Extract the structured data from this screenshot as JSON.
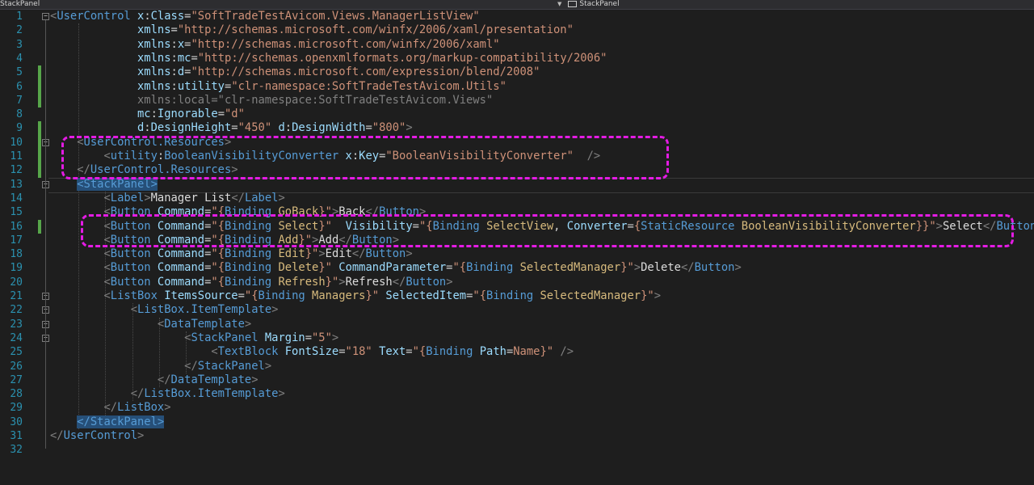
{
  "editor": {
    "nav_left": "StackPanel",
    "nav_right": "StackPanel",
    "line_numbers": [
      "1",
      "2",
      "3",
      "4",
      "5",
      "6",
      "7",
      "8",
      "9",
      "10",
      "11",
      "12",
      "13",
      "14",
      "15",
      "16",
      "17",
      "18",
      "19",
      "20",
      "21",
      "22",
      "23",
      "24",
      "25",
      "26",
      "27",
      "28",
      "29",
      "30",
      "31",
      "32"
    ],
    "lines": [
      [
        [
          "d",
          "<"
        ],
        [
          "t",
          "UserControl"
        ],
        [
          "p",
          " "
        ],
        [
          "a",
          "x"
        ],
        [
          "p",
          ":"
        ],
        [
          "a",
          "Class"
        ],
        [
          "p",
          "="
        ],
        [
          "v",
          "\"SoftTradeTestAvicom.Views.ManagerListView\""
        ]
      ],
      [
        [
          "p",
          "             "
        ],
        [
          "a",
          "xmlns"
        ],
        [
          "p",
          "="
        ],
        [
          "v",
          "\"http://schemas.microsoft.com/winfx/2006/xaml/presentation\""
        ]
      ],
      [
        [
          "p",
          "             "
        ],
        [
          "a",
          "xmlns"
        ],
        [
          "p",
          ":"
        ],
        [
          "a",
          "x"
        ],
        [
          "p",
          "="
        ],
        [
          "v",
          "\"http://schemas.microsoft.com/winfx/2006/xaml\""
        ]
      ],
      [
        [
          "p",
          "             "
        ],
        [
          "a",
          "xmlns"
        ],
        [
          "p",
          ":"
        ],
        [
          "a",
          "mc"
        ],
        [
          "p",
          "="
        ],
        [
          "v",
          "\"http://schemas.openxmlformats.org/markup-compatibility/2006\""
        ]
      ],
      [
        [
          "p",
          "             "
        ],
        [
          "a",
          "xmlns"
        ],
        [
          "p",
          ":"
        ],
        [
          "a",
          "d"
        ],
        [
          "p",
          "="
        ],
        [
          "v",
          "\"http://schemas.microsoft.com/expression/blend/2008\""
        ]
      ],
      [
        [
          "p",
          "             "
        ],
        [
          "a",
          "xmlns"
        ],
        [
          "p",
          ":"
        ],
        [
          "a",
          "utility"
        ],
        [
          "p",
          "="
        ],
        [
          "v",
          "\"clr-namespace:SoftTradeTestAvicom.Utils\""
        ]
      ],
      [
        [
          "p",
          "             "
        ],
        [
          "d",
          "xmlns:local=\"clr-namespace:SoftTradeTestAvicom.Views\""
        ]
      ],
      [
        [
          "p",
          "             "
        ],
        [
          "a",
          "mc"
        ],
        [
          "p",
          ":"
        ],
        [
          "a",
          "Ignorable"
        ],
        [
          "p",
          "="
        ],
        [
          "v",
          "\"d\""
        ]
      ],
      [
        [
          "p",
          "             "
        ],
        [
          "a",
          "d"
        ],
        [
          "p",
          ":"
        ],
        [
          "a",
          "DesignHeight"
        ],
        [
          "p",
          "="
        ],
        [
          "v",
          "\"450\""
        ],
        [
          "p",
          " "
        ],
        [
          "a",
          "d"
        ],
        [
          "p",
          ":"
        ],
        [
          "a",
          "DesignWidth"
        ],
        [
          "p",
          "="
        ],
        [
          "v",
          "\"800\""
        ],
        [
          "d",
          ">"
        ]
      ],
      [
        [
          "p",
          "    "
        ],
        [
          "d",
          "<"
        ],
        [
          "t",
          "UserControl.Resources"
        ],
        [
          "d",
          ">"
        ]
      ],
      [
        [
          "p",
          "        "
        ],
        [
          "d",
          "<"
        ],
        [
          "t",
          "utility"
        ],
        [
          "p",
          ":"
        ],
        [
          "t",
          "BooleanVisibilityConverter"
        ],
        [
          "p",
          " "
        ],
        [
          "a",
          "x"
        ],
        [
          "p",
          ":"
        ],
        [
          "a",
          "Key"
        ],
        [
          "p",
          "="
        ],
        [
          "v",
          "\"BooleanVisibilityConverter\""
        ],
        [
          "p",
          "  "
        ],
        [
          "d",
          "/>"
        ]
      ],
      [
        [
          "p",
          "    "
        ],
        [
          "d",
          "</"
        ],
        [
          "t",
          "UserControl.Resources"
        ],
        [
          "d",
          ">"
        ]
      ],
      [
        [
          "p",
          "    "
        ],
        [
          "hl",
          "<StackPanel>"
        ]
      ],
      [
        [
          "p",
          "        "
        ],
        [
          "d",
          "<"
        ],
        [
          "t",
          "Label"
        ],
        [
          "d",
          ">"
        ],
        [
          "txt",
          "Manager List"
        ],
        [
          "d",
          "</"
        ],
        [
          "t",
          "Label"
        ],
        [
          "d",
          ">"
        ]
      ],
      [
        [
          "p",
          "        "
        ],
        [
          "d",
          "<"
        ],
        [
          "t",
          "Button"
        ],
        [
          "p",
          " "
        ],
        [
          "a",
          "Command"
        ],
        [
          "p",
          "="
        ],
        [
          "v",
          "\"{"
        ],
        [
          "t",
          "Binding"
        ],
        [
          "p",
          " "
        ],
        [
          "bnd",
          "GoBack"
        ],
        [
          "v",
          "}\""
        ],
        [
          "d",
          ">"
        ],
        [
          "txt",
          "Back"
        ],
        [
          "d",
          "</"
        ],
        [
          "t",
          "Button"
        ],
        [
          "d",
          ">"
        ]
      ],
      [
        [
          "p",
          "        "
        ],
        [
          "d",
          "<"
        ],
        [
          "t",
          "Button"
        ],
        [
          "p",
          " "
        ],
        [
          "a",
          "Command"
        ],
        [
          "p",
          "="
        ],
        [
          "v",
          "\"{"
        ],
        [
          "t",
          "Binding"
        ],
        [
          "p",
          " "
        ],
        [
          "bnd",
          "Select"
        ],
        [
          "v",
          "}\""
        ],
        [
          "p",
          "  "
        ],
        [
          "a",
          "Visibility"
        ],
        [
          "p",
          "="
        ],
        [
          "v",
          "\"{"
        ],
        [
          "t",
          "Binding"
        ],
        [
          "p",
          " "
        ],
        [
          "bnd",
          "SelectView"
        ],
        [
          "p",
          ", "
        ],
        [
          "a",
          "Converter"
        ],
        [
          "p",
          "="
        ],
        [
          "v",
          "{"
        ],
        [
          "t",
          "StaticResource"
        ],
        [
          "p",
          " "
        ],
        [
          "bnd",
          "BooleanVisibilityConverter"
        ],
        [
          "v",
          "}}\""
        ],
        [
          "d",
          ">"
        ],
        [
          "txt",
          "Select"
        ],
        [
          "d",
          "</"
        ],
        [
          "t",
          "Button"
        ],
        [
          "d",
          ">"
        ]
      ],
      [
        [
          "p",
          "        "
        ],
        [
          "d",
          "<"
        ],
        [
          "t",
          "Button"
        ],
        [
          "p",
          " "
        ],
        [
          "a",
          "Command"
        ],
        [
          "p",
          "="
        ],
        [
          "v",
          "\"{"
        ],
        [
          "t",
          "Binding"
        ],
        [
          "p",
          " "
        ],
        [
          "bnd",
          "Add"
        ],
        [
          "v",
          "}\""
        ],
        [
          "d",
          ">"
        ],
        [
          "txt",
          "Add"
        ],
        [
          "d",
          "</"
        ],
        [
          "t",
          "Button"
        ],
        [
          "d",
          ">"
        ]
      ],
      [
        [
          "p",
          "        "
        ],
        [
          "d",
          "<"
        ],
        [
          "t",
          "Button"
        ],
        [
          "p",
          " "
        ],
        [
          "a",
          "Command"
        ],
        [
          "p",
          "="
        ],
        [
          "v",
          "\"{"
        ],
        [
          "t",
          "Binding"
        ],
        [
          "p",
          " "
        ],
        [
          "bnd",
          "Edit"
        ],
        [
          "v",
          "}\""
        ],
        [
          "d",
          ">"
        ],
        [
          "txt",
          "Edit"
        ],
        [
          "d",
          "</"
        ],
        [
          "t",
          "Button"
        ],
        [
          "d",
          ">"
        ]
      ],
      [
        [
          "p",
          "        "
        ],
        [
          "d",
          "<"
        ],
        [
          "t",
          "Button"
        ],
        [
          "p",
          " "
        ],
        [
          "a",
          "Command"
        ],
        [
          "p",
          "="
        ],
        [
          "v",
          "\"{"
        ],
        [
          "t",
          "Binding"
        ],
        [
          "p",
          " "
        ],
        [
          "bnd",
          "Delete"
        ],
        [
          "v",
          "}\""
        ],
        [
          "p",
          " "
        ],
        [
          "a",
          "CommandParameter"
        ],
        [
          "p",
          "="
        ],
        [
          "v",
          "\"{"
        ],
        [
          "t",
          "Binding"
        ],
        [
          "p",
          " "
        ],
        [
          "bnd",
          "SelectedManager"
        ],
        [
          "v",
          "}\""
        ],
        [
          "d",
          ">"
        ],
        [
          "txt",
          "Delete"
        ],
        [
          "d",
          "</"
        ],
        [
          "t",
          "Button"
        ],
        [
          "d",
          ">"
        ]
      ],
      [
        [
          "p",
          "        "
        ],
        [
          "d",
          "<"
        ],
        [
          "t",
          "Button"
        ],
        [
          "p",
          " "
        ],
        [
          "a",
          "Command"
        ],
        [
          "p",
          "="
        ],
        [
          "v",
          "\"{"
        ],
        [
          "t",
          "Binding"
        ],
        [
          "p",
          " "
        ],
        [
          "bnd",
          "Refresh"
        ],
        [
          "v",
          "}\""
        ],
        [
          "d",
          ">"
        ],
        [
          "txt",
          "Refresh"
        ],
        [
          "d",
          "</"
        ],
        [
          "t",
          "Button"
        ],
        [
          "d",
          ">"
        ]
      ],
      [
        [
          "p",
          "        "
        ],
        [
          "d",
          "<"
        ],
        [
          "t",
          "ListBox"
        ],
        [
          "p",
          " "
        ],
        [
          "a",
          "ItemsSource"
        ],
        [
          "p",
          "="
        ],
        [
          "v",
          "\"{"
        ],
        [
          "t",
          "Binding"
        ],
        [
          "p",
          " "
        ],
        [
          "bnd",
          "Managers"
        ],
        [
          "v",
          "}\""
        ],
        [
          "p",
          " "
        ],
        [
          "a",
          "SelectedItem"
        ],
        [
          "p",
          "="
        ],
        [
          "v",
          "\"{"
        ],
        [
          "t",
          "Binding"
        ],
        [
          "p",
          " "
        ],
        [
          "bnd",
          "SelectedManager"
        ],
        [
          "v",
          "}\""
        ],
        [
          "d",
          ">"
        ]
      ],
      [
        [
          "p",
          "            "
        ],
        [
          "d",
          "<"
        ],
        [
          "t",
          "ListBox.ItemTemplate"
        ],
        [
          "d",
          ">"
        ]
      ],
      [
        [
          "p",
          "                "
        ],
        [
          "d",
          "<"
        ],
        [
          "t",
          "DataTemplate"
        ],
        [
          "d",
          ">"
        ]
      ],
      [
        [
          "p",
          "                    "
        ],
        [
          "d",
          "<"
        ],
        [
          "t",
          "StackPanel"
        ],
        [
          "p",
          " "
        ],
        [
          "a",
          "Margin"
        ],
        [
          "p",
          "="
        ],
        [
          "v",
          "\"5\""
        ],
        [
          "d",
          ">"
        ]
      ],
      [
        [
          "p",
          "                        "
        ],
        [
          "d",
          "<"
        ],
        [
          "t",
          "TextBlock"
        ],
        [
          "p",
          " "
        ],
        [
          "a",
          "FontSize"
        ],
        [
          "p",
          "="
        ],
        [
          "v",
          "\"18\""
        ],
        [
          "p",
          " "
        ],
        [
          "a",
          "Text"
        ],
        [
          "p",
          "="
        ],
        [
          "v",
          "\"{"
        ],
        [
          "t",
          "Binding"
        ],
        [
          "p",
          " "
        ],
        [
          "a",
          "Path"
        ],
        [
          "p",
          "="
        ],
        [
          "v",
          "Name}\""
        ],
        [
          "p",
          " "
        ],
        [
          "d",
          "/>"
        ]
      ],
      [
        [
          "p",
          "                    "
        ],
        [
          "d",
          "</"
        ],
        [
          "t",
          "StackPanel"
        ],
        [
          "d",
          ">"
        ]
      ],
      [
        [
          "p",
          "                "
        ],
        [
          "d",
          "</"
        ],
        [
          "t",
          "DataTemplate"
        ],
        [
          "d",
          ">"
        ]
      ],
      [
        [
          "p",
          "            "
        ],
        [
          "d",
          "</"
        ],
        [
          "t",
          "ListBox.ItemTemplate"
        ],
        [
          "d",
          ">"
        ]
      ],
      [
        [
          "p",
          "        "
        ],
        [
          "d",
          "</"
        ],
        [
          "t",
          "ListBox"
        ],
        [
          "d",
          ">"
        ]
      ],
      [
        [
          "p",
          "    "
        ],
        [
          "hl",
          "</StackPanel>"
        ]
      ],
      [
        [
          "d",
          "</"
        ],
        [
          "t",
          "UserControl"
        ],
        [
          "d",
          ">"
        ]
      ],
      []
    ]
  },
  "colors": {
    "background": "#1e1e1e",
    "line_number": "#2b91af",
    "tag": "#569cd6",
    "attribute": "#9cdcfe",
    "value": "#ce9178",
    "binding_path": "#d7ba7d",
    "annotation": "#e41be4",
    "modified_marker": "#57a64a",
    "selection": "#264f78"
  },
  "icons": {
    "nav_dropdown": "chevron-down-icon",
    "nav_element": "xaml-element-icon",
    "outline_toggle": "collapse-minus-icon"
  }
}
